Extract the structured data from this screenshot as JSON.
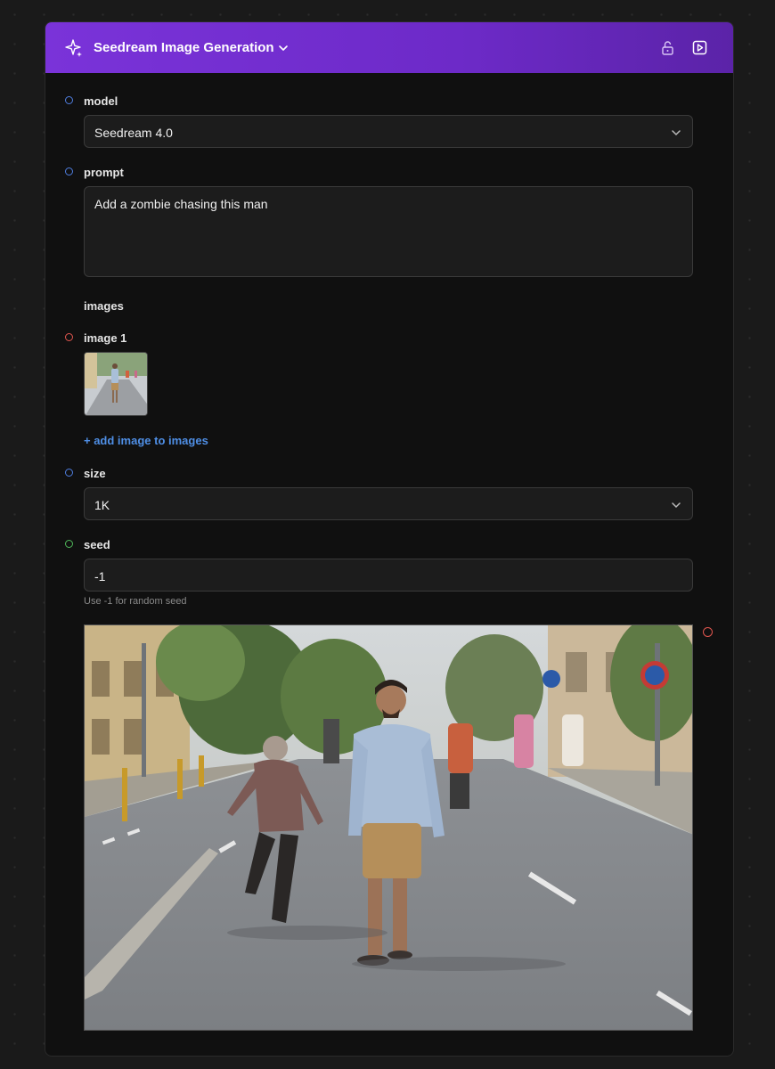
{
  "node": {
    "title": "Seedream Image Generation",
    "accent_color": "#7a33d9",
    "icons": [
      "sparkles-icon",
      "chevron-down-icon",
      "unlock-icon",
      "play-icon"
    ]
  },
  "fields": {
    "model": {
      "label": "model",
      "value": "Seedream 4.0",
      "port_color": "#4f7ee0"
    },
    "prompt": {
      "label": "prompt",
      "value": "Add a zombie chasing this man",
      "port_color": "#4f7ee0"
    },
    "images": {
      "label": "images",
      "item_label": "image 1",
      "add_label": "+ add image to images",
      "port_color": "#e0564f"
    },
    "size": {
      "label": "size",
      "value": "1K",
      "port_color": "#4f7ee0"
    },
    "seed": {
      "label": "seed",
      "value": "-1",
      "hint": "Use -1 for random seed",
      "port_color": "#4fb85a"
    }
  },
  "output": {
    "port_color": "#e0564f"
  }
}
